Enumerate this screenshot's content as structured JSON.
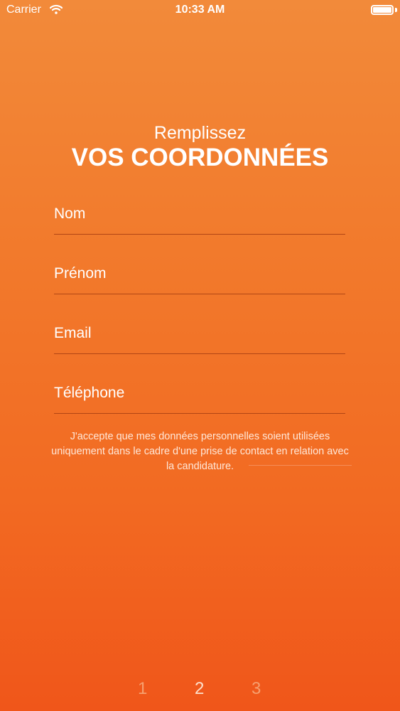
{
  "status_bar": {
    "carrier": "Carrier",
    "time": "10:33 AM"
  },
  "heading": {
    "subtitle": "Remplissez",
    "title": "VOS COORDONNÉES"
  },
  "form": {
    "fields": [
      {
        "placeholder": "Nom",
        "value": ""
      },
      {
        "placeholder": "Prénom",
        "value": ""
      },
      {
        "placeholder": "Email",
        "value": ""
      },
      {
        "placeholder": "Téléphone",
        "value": ""
      }
    ],
    "consent": "J'accepte que mes données personnelles soient utilisées uniquement dans le cadre d'une prise de contact en relation avec la candidature."
  },
  "pager": {
    "pages": [
      "1",
      "2",
      "3"
    ],
    "active_index": 1
  },
  "colors": {
    "gradient_top": "#f28a3a",
    "gradient_bottom": "#f0561a",
    "underline": "#b14514"
  }
}
